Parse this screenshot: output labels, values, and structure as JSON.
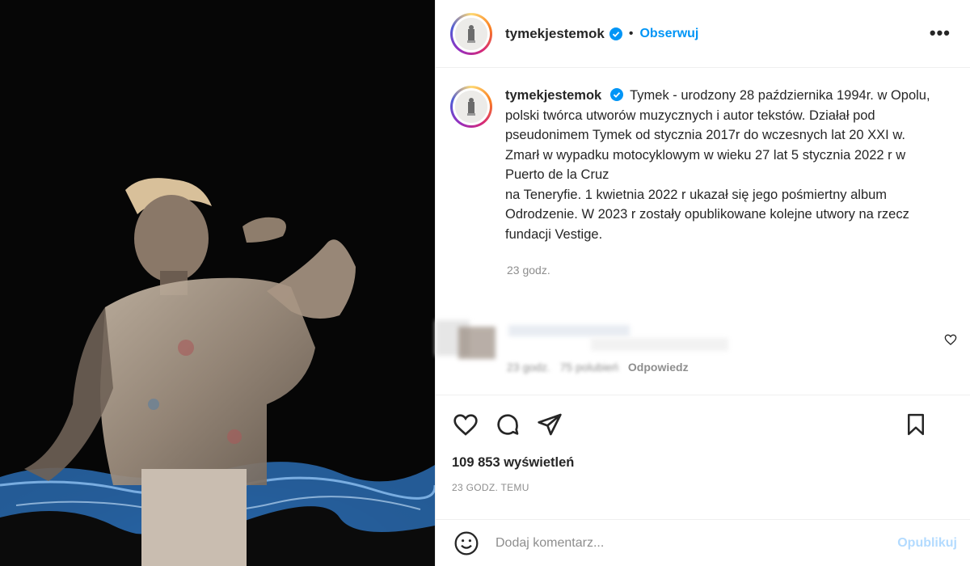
{
  "post": {
    "username": "tymekjestemok",
    "verified": true,
    "follow_label": "Obserwuj",
    "more_icon": "more-options-icon",
    "caption_username": "tymekjestemok",
    "caption_text": "Tymek - urodzony 28 października 1994r. w Opolu, polski twórca utworów muzycznych i autor tekstów. Działał pod pseudonimem Tymek od stycznia 2017r do wczesnych lat 20 XXI w.",
    "caption_line2": "Zmarł w wypadku motocyklowym w wieku 27 lat 5 stycznia 2022 r w Puerto de la Cruz",
    "caption_line3": "na Teneryfie. 1 kwietnia 2022 r ukazał się jego pośmiertny album Odrodzenie. W 2023 r zostały opublikowane kolejne utwory na rzecz fundacji Vestige.",
    "caption_time": "23 godz.",
    "views": "109 853 wyświetleń",
    "timestamp": "23 GODZ. TEMU"
  },
  "comment": {
    "time_blurred": "23 godz.",
    "likes_blurred": "75 polubień",
    "reply_label": "Odpowiedz"
  },
  "add_comment": {
    "placeholder": "Dodaj komentarz...",
    "publish_label": "Opublikuj"
  },
  "colors": {
    "accent": "#0095f6",
    "publish_disabled": "#b3dbff",
    "muted": "#8e8e8e"
  }
}
